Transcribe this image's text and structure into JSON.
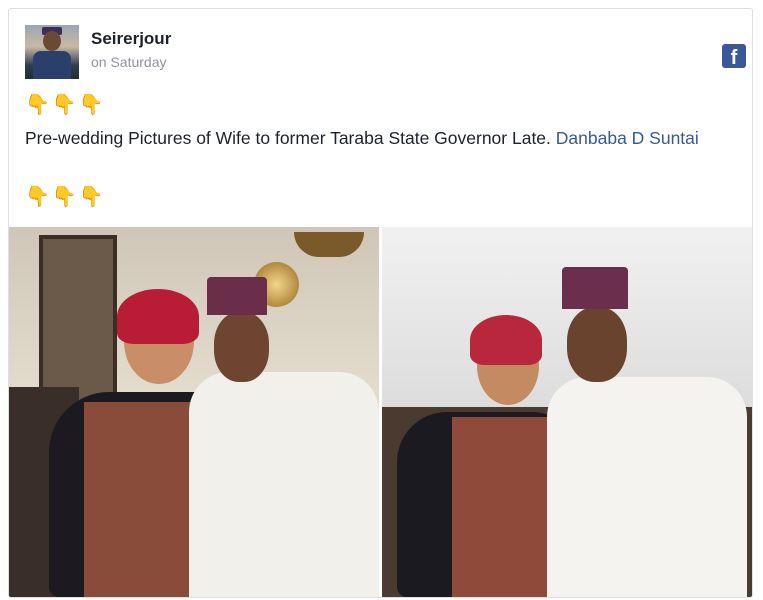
{
  "post": {
    "author": "Seirerjour",
    "timestamp": "on Saturday",
    "emoji_top": [
      "👇",
      "👇",
      "👇"
    ],
    "text": "Pre-wedding Pictures of Wife to former Taraba State Governor Late. ",
    "link_text": "Danbaba D Suntai",
    "emoji_bottom": [
      "👇",
      "👇",
      "👇"
    ],
    "platform_icon": "facebook-icon",
    "icon_glyph": "f"
  },
  "photos": [
    {
      "name": "photo-couple-indoor",
      "icon": "photo"
    },
    {
      "name": "photo-couple-white-backdrop",
      "icon": "photo"
    }
  ],
  "colors": {
    "link": "#385898",
    "facebook": "#3b5998",
    "timestamp": "#90949c"
  }
}
